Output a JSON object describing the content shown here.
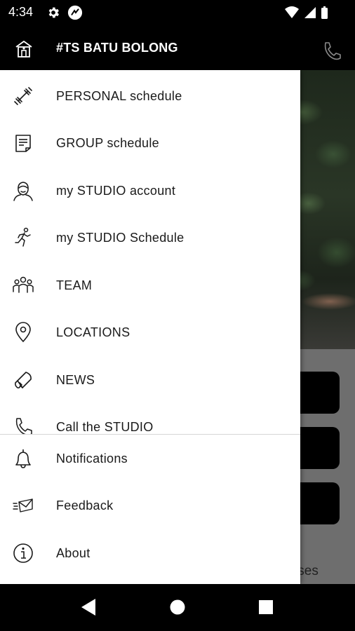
{
  "status_bar": {
    "time": "4:34",
    "icons": [
      "gear-icon",
      "app-notification-icon",
      "wifi-icon",
      "signal-icon",
      "battery-icon"
    ]
  },
  "app_bar": {
    "title": "#TS BATU BOLONG",
    "left_icon": "studio-home-icon",
    "right_icon": "phone-icon"
  },
  "drawer": {
    "items": [
      {
        "label": "PERSONAL schedule",
        "icon": "dumbbell-icon"
      },
      {
        "label": "GROUP schedule",
        "icon": "document-icon"
      },
      {
        "label": "my STUDIO account",
        "icon": "person-icon"
      },
      {
        "label": "my STUDIO Schedule",
        "icon": "runner-icon"
      },
      {
        "label": "TEAM",
        "icon": "team-icon"
      },
      {
        "label": "LOCATIONS",
        "icon": "location-pin-icon"
      },
      {
        "label": "NEWS",
        "icon": "megaphone-icon"
      },
      {
        "label": "Call the STUDIO",
        "icon": "phone-icon"
      }
    ],
    "footer_items": [
      {
        "label": "Notifications",
        "icon": "bell-icon"
      },
      {
        "label": "Feedback",
        "icon": "feedback-envelope-icon"
      },
      {
        "label": "About",
        "icon": "info-icon"
      }
    ]
  },
  "background": {
    "partial_text": "lasses"
  },
  "nav_bar": {
    "icons": [
      "back-icon",
      "home-icon",
      "recents-icon"
    ]
  }
}
